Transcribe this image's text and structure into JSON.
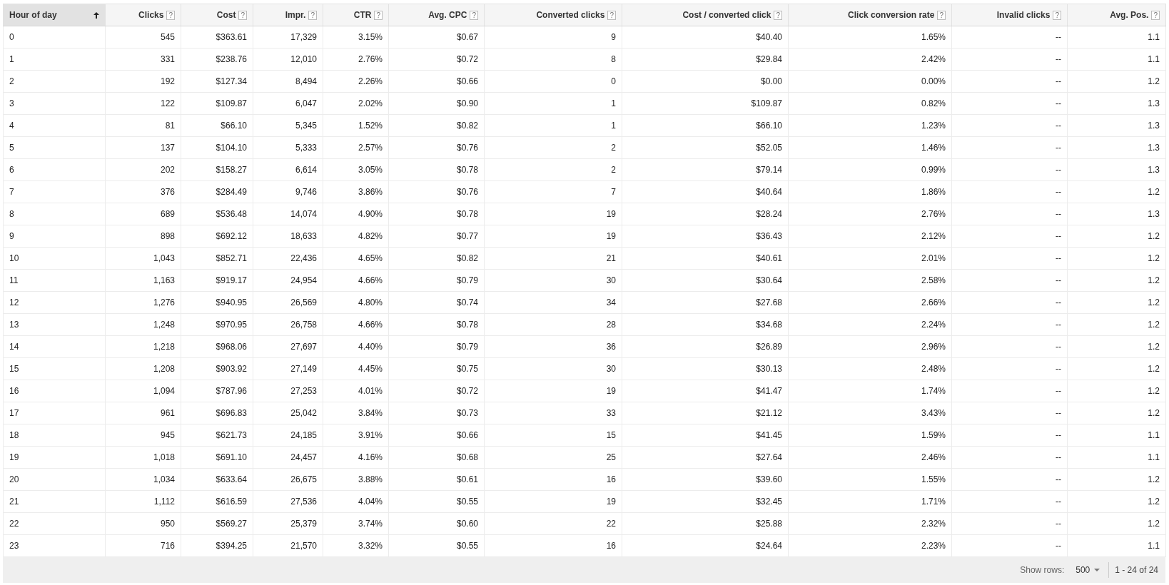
{
  "table": {
    "columns": [
      {
        "label": "Hour of day",
        "sorted": true
      },
      {
        "label": "Clicks",
        "sorted": false,
        "help": "?"
      },
      {
        "label": "Cost",
        "sorted": false,
        "help": "?"
      },
      {
        "label": "Impr.",
        "sorted": false,
        "help": "?"
      },
      {
        "label": "CTR",
        "sorted": false,
        "help": "?"
      },
      {
        "label": "Avg. CPC",
        "sorted": false,
        "help": "?"
      },
      {
        "label": "Converted clicks",
        "sorted": false,
        "help": "?"
      },
      {
        "label": "Cost / converted click",
        "sorted": false,
        "help": "?"
      },
      {
        "label": "Click conversion rate",
        "sorted": false,
        "help": "?"
      },
      {
        "label": "Invalid clicks",
        "sorted": false,
        "help": "?"
      },
      {
        "label": "Avg. Pos.",
        "sorted": false,
        "help": "?"
      }
    ],
    "rows": [
      [
        "0",
        "545",
        "$363.61",
        "17,329",
        "3.15%",
        "$0.67",
        "9",
        "$40.40",
        "1.65%",
        "--",
        "1.1"
      ],
      [
        "1",
        "331",
        "$238.76",
        "12,010",
        "2.76%",
        "$0.72",
        "8",
        "$29.84",
        "2.42%",
        "--",
        "1.1"
      ],
      [
        "2",
        "192",
        "$127.34",
        "8,494",
        "2.26%",
        "$0.66",
        "0",
        "$0.00",
        "0.00%",
        "--",
        "1.2"
      ],
      [
        "3",
        "122",
        "$109.87",
        "6,047",
        "2.02%",
        "$0.90",
        "1",
        "$109.87",
        "0.82%",
        "--",
        "1.3"
      ],
      [
        "4",
        "81",
        "$66.10",
        "5,345",
        "1.52%",
        "$0.82",
        "1",
        "$66.10",
        "1.23%",
        "--",
        "1.3"
      ],
      [
        "5",
        "137",
        "$104.10",
        "5,333",
        "2.57%",
        "$0.76",
        "2",
        "$52.05",
        "1.46%",
        "--",
        "1.3"
      ],
      [
        "6",
        "202",
        "$158.27",
        "6,614",
        "3.05%",
        "$0.78",
        "2",
        "$79.14",
        "0.99%",
        "--",
        "1.3"
      ],
      [
        "7",
        "376",
        "$284.49",
        "9,746",
        "3.86%",
        "$0.76",
        "7",
        "$40.64",
        "1.86%",
        "--",
        "1.2"
      ],
      [
        "8",
        "689",
        "$536.48",
        "14,074",
        "4.90%",
        "$0.78",
        "19",
        "$28.24",
        "2.76%",
        "--",
        "1.3"
      ],
      [
        "9",
        "898",
        "$692.12",
        "18,633",
        "4.82%",
        "$0.77",
        "19",
        "$36.43",
        "2.12%",
        "--",
        "1.2"
      ],
      [
        "10",
        "1,043",
        "$852.71",
        "22,436",
        "4.65%",
        "$0.82",
        "21",
        "$40.61",
        "2.01%",
        "--",
        "1.2"
      ],
      [
        "11",
        "1,163",
        "$919.17",
        "24,954",
        "4.66%",
        "$0.79",
        "30",
        "$30.64",
        "2.58%",
        "--",
        "1.2"
      ],
      [
        "12",
        "1,276",
        "$940.95",
        "26,569",
        "4.80%",
        "$0.74",
        "34",
        "$27.68",
        "2.66%",
        "--",
        "1.2"
      ],
      [
        "13",
        "1,248",
        "$970.95",
        "26,758",
        "4.66%",
        "$0.78",
        "28",
        "$34.68",
        "2.24%",
        "--",
        "1.2"
      ],
      [
        "14",
        "1,218",
        "$968.06",
        "27,697",
        "4.40%",
        "$0.79",
        "36",
        "$26.89",
        "2.96%",
        "--",
        "1.2"
      ],
      [
        "15",
        "1,208",
        "$903.92",
        "27,149",
        "4.45%",
        "$0.75",
        "30",
        "$30.13",
        "2.48%",
        "--",
        "1.2"
      ],
      [
        "16",
        "1,094",
        "$787.96",
        "27,253",
        "4.01%",
        "$0.72",
        "19",
        "$41.47",
        "1.74%",
        "--",
        "1.2"
      ],
      [
        "17",
        "961",
        "$696.83",
        "25,042",
        "3.84%",
        "$0.73",
        "33",
        "$21.12",
        "3.43%",
        "--",
        "1.2"
      ],
      [
        "18",
        "945",
        "$621.73",
        "24,185",
        "3.91%",
        "$0.66",
        "15",
        "$41.45",
        "1.59%",
        "--",
        "1.1"
      ],
      [
        "19",
        "1,018",
        "$691.10",
        "24,457",
        "4.16%",
        "$0.68",
        "25",
        "$27.64",
        "2.46%",
        "--",
        "1.1"
      ],
      [
        "20",
        "1,034",
        "$633.64",
        "26,675",
        "3.88%",
        "$0.61",
        "16",
        "$39.60",
        "1.55%",
        "--",
        "1.2"
      ],
      [
        "21",
        "1,112",
        "$616.59",
        "27,536",
        "4.04%",
        "$0.55",
        "19",
        "$32.45",
        "1.71%",
        "--",
        "1.2"
      ],
      [
        "22",
        "950",
        "$569.27",
        "25,379",
        "3.74%",
        "$0.60",
        "22",
        "$25.88",
        "2.32%",
        "--",
        "1.2"
      ],
      [
        "23",
        "716",
        "$394.25",
        "21,570",
        "3.32%",
        "$0.55",
        "16",
        "$24.64",
        "2.23%",
        "--",
        "1.1"
      ]
    ]
  },
  "footer": {
    "show_rows_label": "Show rows:",
    "rows_per_page": "500",
    "range": "1 - 24 of 24"
  }
}
